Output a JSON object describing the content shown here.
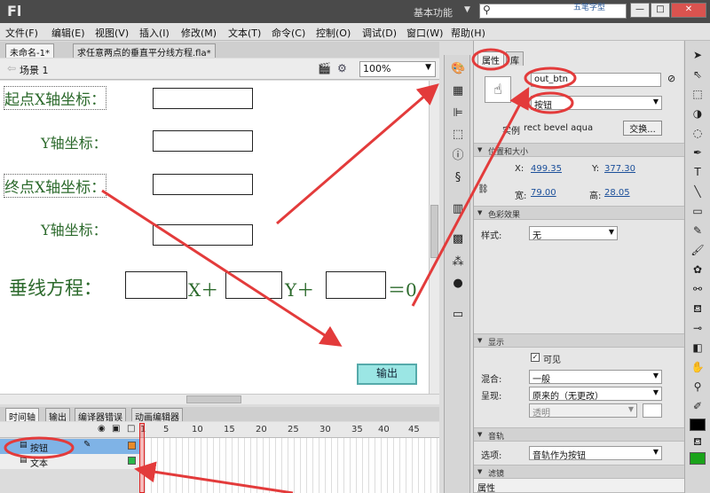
{
  "app": {
    "logo": "Fl",
    "workspace": "基本功能",
    "watermark": "五笔字型"
  },
  "menu": [
    "文件(F)",
    "编辑(E)",
    "视图(V)",
    "插入(I)",
    "修改(M)",
    "文本(T)",
    "命令(C)",
    "控制(O)",
    "调试(D)",
    "窗口(W)",
    "帮助(H)"
  ],
  "doc_tabs": [
    "未命名-1*",
    "求任意两点的垂直平分线方程.fla*"
  ],
  "scene": {
    "label": "场景 1",
    "zoom": "100%"
  },
  "stage": {
    "start_x": "起点X轴坐标：",
    "start_y": "Y轴坐标：",
    "end_x": "终点X轴坐标：",
    "end_y": "Y轴坐标：",
    "eq_label": "垂线方程：",
    "eq_x": "X＋",
    "eq_y": "Y＋",
    "eq_zero": "＝0",
    "button": "输出"
  },
  "timeline": {
    "tabs": [
      "时间轴",
      "输出",
      "编译器错误",
      "动画编辑器"
    ],
    "frame_numbers": [
      "1",
      "5",
      "10",
      "15",
      "20",
      "25",
      "30",
      "35",
      "40",
      "45"
    ],
    "layers": [
      {
        "name": "按钮",
        "selected": true
      },
      {
        "name": "文本",
        "selected": false
      }
    ]
  },
  "properties": {
    "tabs": [
      "属性",
      "库"
    ],
    "instance_name": "out_btn",
    "type": "按钮",
    "instance_of_label": "实例",
    "instance_of": "rect bevel aqua",
    "swap_label": "交换...",
    "position": {
      "header": "位置和大小",
      "x_label": "X:",
      "x": "499.35",
      "y_label": "Y:",
      "y": "377.30",
      "w_label": "宽:",
      "w": "79.00",
      "h_label": "高:",
      "h": "28.05"
    },
    "color": {
      "header": "色彩效果",
      "style_label": "样式:",
      "style": "无"
    },
    "display": {
      "header": "显示",
      "visible_label": "可见",
      "blend_label": "混合:",
      "blend": "一般",
      "render_label": "呈现:",
      "render": "原来的（无更改）",
      "transparent": "透明"
    },
    "track": {
      "header": "音轨",
      "option_label": "选项:",
      "option": "音轨作为按钮"
    },
    "filters": {
      "header": "滤镜",
      "col": "属性"
    }
  },
  "colors": {
    "annotation": "#e33b3b",
    "label_green": "#2c6a2c",
    "button_fill": "#9be6e4",
    "fill_swatch": "#1aa31a"
  }
}
